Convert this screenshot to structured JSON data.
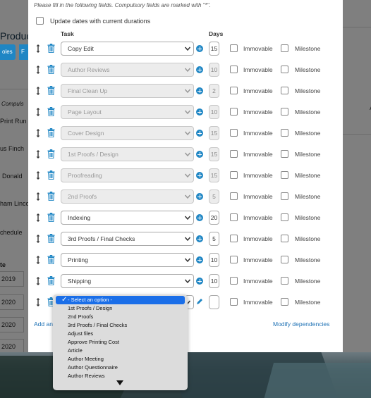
{
  "background": {
    "left_texts": [
      "Produc",
      "oles",
      "F",
      "Compuls",
      "Print Run",
      "us Finch",
      "Donald",
      "ham Linco",
      "chedule",
      "te",
      "2019",
      "2020",
      "2020",
      "2020"
    ],
    "right_texts": [
      "A"
    ]
  },
  "form": {
    "instruction": "Please fill in the following fields. Compulsory fields are marked with \"*\".",
    "update_label": "Update dates with current durations",
    "headers": {
      "task": "Task",
      "days": "Days"
    },
    "immovable_label": "Immovable",
    "milestone_label": "Milestone",
    "rows": [
      {
        "task": "Copy Edit",
        "days": "15",
        "disabled": false
      },
      {
        "task": "Author Reviews",
        "days": "10",
        "disabled": true
      },
      {
        "task": "Final Clean Up",
        "days": "2",
        "disabled": true
      },
      {
        "task": "Page Layout",
        "days": "10",
        "disabled": true
      },
      {
        "task": "Cover Design",
        "days": "15",
        "disabled": true
      },
      {
        "task": "1st Proofs / Design",
        "days": "15",
        "disabled": true
      },
      {
        "task": "Proofreading",
        "days": "15",
        "disabled": true
      },
      {
        "task": "2nd Proofs",
        "days": "5",
        "disabled": true
      },
      {
        "task": "Indexing",
        "days": "20",
        "disabled": false
      },
      {
        "task": "3rd Proofs / Final Checks",
        "days": "5",
        "disabled": false
      },
      {
        "task": "Printing",
        "days": "10",
        "disabled": false
      },
      {
        "task": "Shipping",
        "days": "10",
        "disabled": false
      },
      {
        "task": "",
        "days": "",
        "disabled": false
      }
    ],
    "add_link": "Add an",
    "modify_link": "Modify dependencies"
  },
  "dropdown": {
    "selected": "- Select an option -",
    "options": [
      "1st Proofs / Design",
      "2nd Proofs",
      "3rd Proofs / Final Checks",
      "Adjust files",
      "Approve Printing Cost",
      "Article",
      "Author Meeting",
      "Author Questionnaire",
      "Author Reviews"
    ]
  },
  "colors": {
    "accent": "#1f86c4",
    "highlight": "#1a6ee8",
    "link": "#1f72b5"
  }
}
